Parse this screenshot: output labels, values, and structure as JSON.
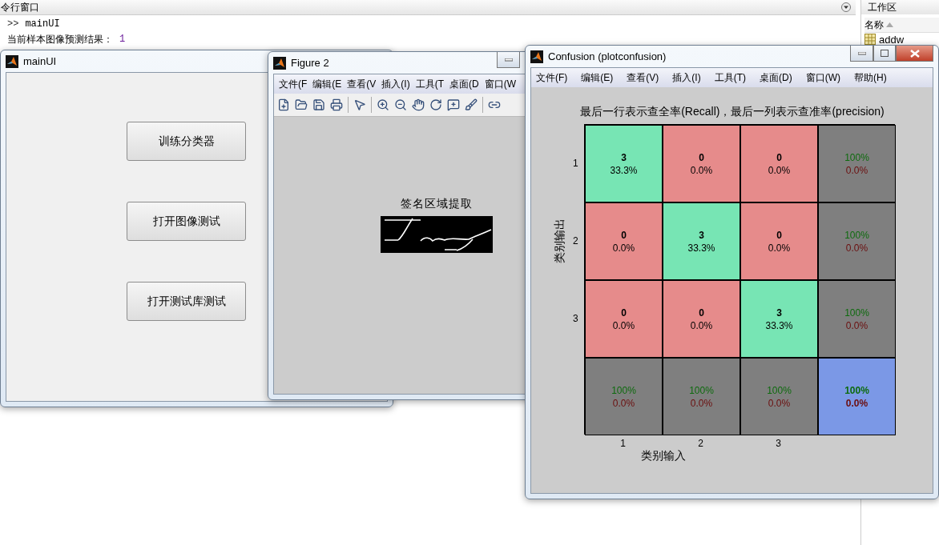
{
  "command_window": {
    "title": "令行窗口",
    "lines": [
      {
        "prompt": ">>",
        "text": "mainUI"
      },
      {
        "text": "当前样本图像预测结果：",
        "value": "1"
      }
    ]
  },
  "workspace": {
    "title": "工作区",
    "column": "名称",
    "items": [
      "addw"
    ]
  },
  "main_ui": {
    "title": "mainUI",
    "buttons": [
      "训练分类器",
      "打开图像测试",
      "打开测试库测试"
    ]
  },
  "figure2": {
    "title": "Figure 2",
    "menu": [
      "文件(F",
      "编辑(E",
      "查看(V",
      "插入(I)",
      "工具(T",
      "桌面(D",
      "窗口(W"
    ],
    "image_title": "签名区域提取"
  },
  "confusion": {
    "title": "Confusion (plotconfusion)",
    "menu": [
      "文件(F)",
      "编辑(E)",
      "查看(V)",
      "插入(I)",
      "工具(T)",
      "桌面(D)",
      "窗口(W)",
      "帮助(H)"
    ],
    "plot_title": "最后一行表示查全率(Recall)，最后一列表示查准率(precision)",
    "ylabel": "类别输出",
    "xlabel": "类别输入",
    "row_labels": [
      "1",
      "2",
      "3"
    ],
    "col_labels": [
      "1",
      "2",
      "3"
    ],
    "rows": [
      [
        {
          "kind": "correct",
          "count": "3",
          "percent": "33.3%"
        },
        {
          "kind": "wrong",
          "count": "0",
          "percent": "0.0%"
        },
        {
          "kind": "wrong",
          "count": "0",
          "percent": "0.0%"
        },
        {
          "kind": "total",
          "count": "100%",
          "percent": "0.0%"
        }
      ],
      [
        {
          "kind": "wrong",
          "count": "0",
          "percent": "0.0%"
        },
        {
          "kind": "correct",
          "count": "3",
          "percent": "33.3%"
        },
        {
          "kind": "wrong",
          "count": "0",
          "percent": "0.0%"
        },
        {
          "kind": "total",
          "count": "100%",
          "percent": "0.0%"
        }
      ],
      [
        {
          "kind": "wrong",
          "count": "0",
          "percent": "0.0%"
        },
        {
          "kind": "wrong",
          "count": "0",
          "percent": "0.0%"
        },
        {
          "kind": "correct",
          "count": "3",
          "percent": "33.3%"
        },
        {
          "kind": "total",
          "count": "100%",
          "percent": "0.0%"
        }
      ],
      [
        {
          "kind": "total",
          "count": "100%",
          "percent": "0.0%"
        },
        {
          "kind": "total",
          "count": "100%",
          "percent": "0.0%"
        },
        {
          "kind": "total",
          "count": "100%",
          "percent": "0.0%"
        },
        {
          "kind": "overall",
          "count": "100%",
          "percent": "0.0%"
        }
      ]
    ]
  }
}
